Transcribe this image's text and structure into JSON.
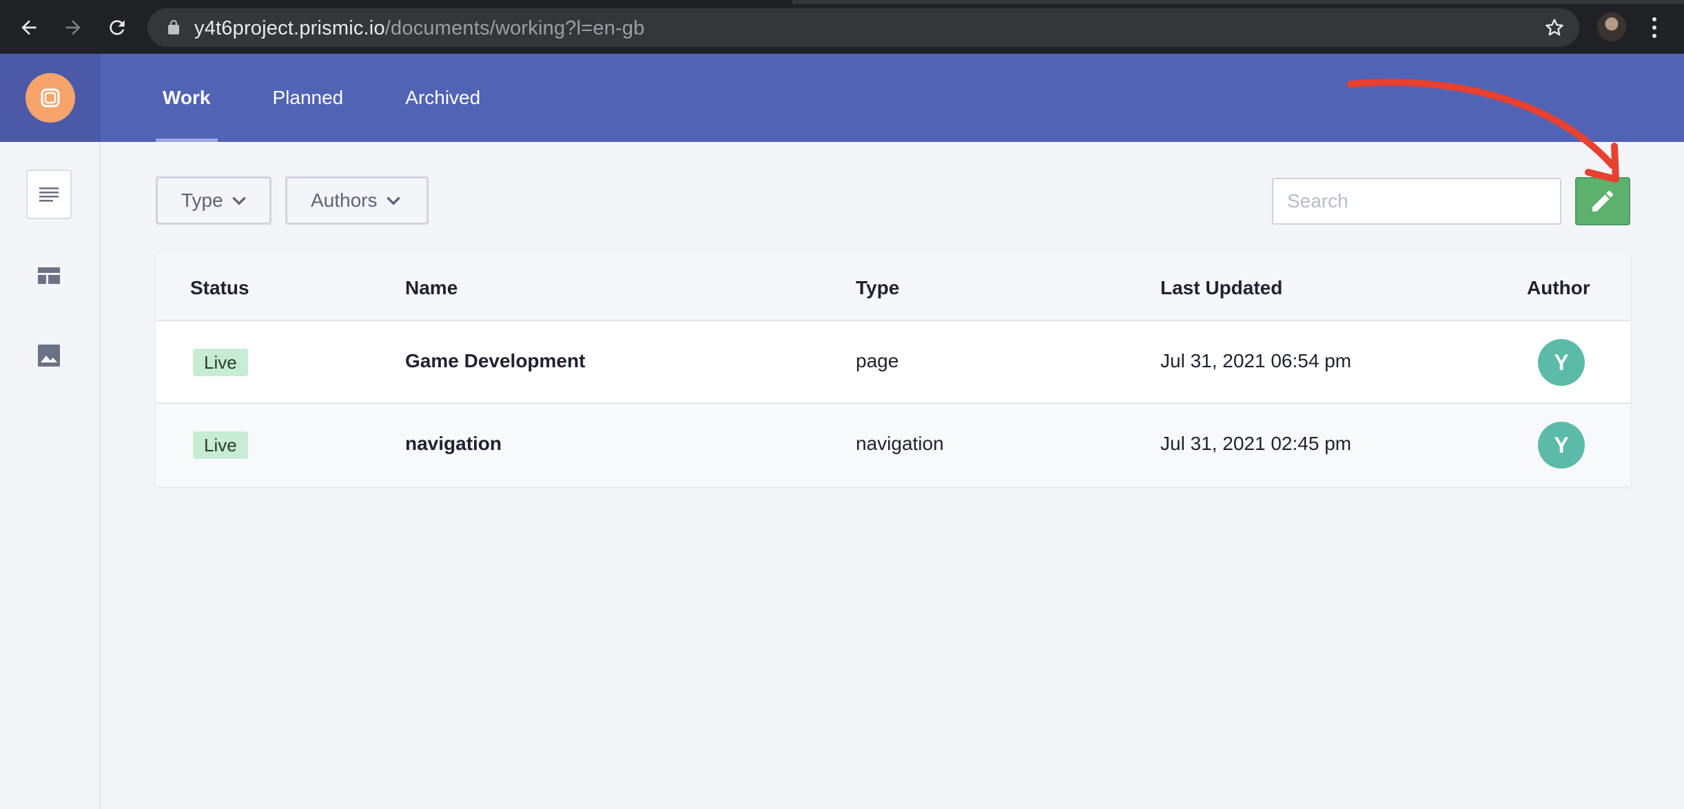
{
  "browser": {
    "url_host": "y4t6project.prismic.io",
    "url_path": "/documents/working?l=en-gb"
  },
  "header": {
    "tabs": [
      {
        "label": "Work",
        "active": true
      },
      {
        "label": "Planned",
        "active": false
      },
      {
        "label": "Archived",
        "active": false
      }
    ]
  },
  "toolbar": {
    "type_filter": "Type",
    "authors_filter": "Authors",
    "search_placeholder": "Search"
  },
  "table": {
    "columns": {
      "status": "Status",
      "name": "Name",
      "type": "Type",
      "last_updated": "Last Updated",
      "author": "Author"
    },
    "rows": [
      {
        "status": "Live",
        "name": "Game Development",
        "type": "page",
        "last_updated": "Jul 31, 2021 06:54 pm",
        "author_initial": "Y"
      },
      {
        "status": "Live",
        "name": "navigation",
        "type": "navigation",
        "last_updated": "Jul 31, 2021 02:45 pm",
        "author_initial": "Y"
      }
    ]
  },
  "icons": {
    "back": "arrow-left-icon",
    "forward": "arrow-right-icon",
    "reload": "reload-icon",
    "lock": "lock-icon",
    "bookmark": "star-icon",
    "menu": "kebab-icon",
    "logo": "prismic-logo-icon",
    "documents": "documents-icon",
    "custom_types": "layout-icon",
    "media": "image-icon",
    "new_document": "pencil-icon",
    "dropdown": "chevron-down-icon"
  },
  "colors": {
    "brand_header": "#5163b5",
    "logo": "#f6a46c",
    "new_button": "#5cb26d",
    "live_badge": "#c6ecd4",
    "avatar": "#5cbba8",
    "annotation_arrow": "#e8412f"
  }
}
